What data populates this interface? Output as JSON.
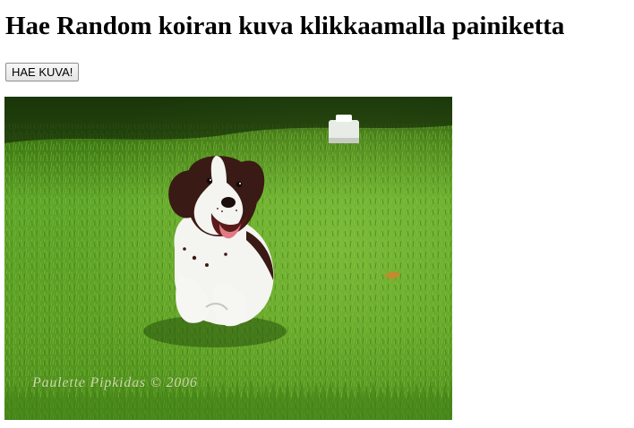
{
  "page": {
    "title": "Hae Random koiran kuva klikkaamalla painiketta",
    "button_label": "HAE KUVA!"
  },
  "photo": {
    "subject": "puppy-running-on-grass",
    "watermark": "Paulette Pipkidas © 2006"
  },
  "colors": {
    "grass_light": "#74b832",
    "grass_mid": "#4f9a1c",
    "grass_dark": "#2b5a10",
    "dog_brown": "#3a1a14",
    "dog_white": "#f4f4f0"
  }
}
